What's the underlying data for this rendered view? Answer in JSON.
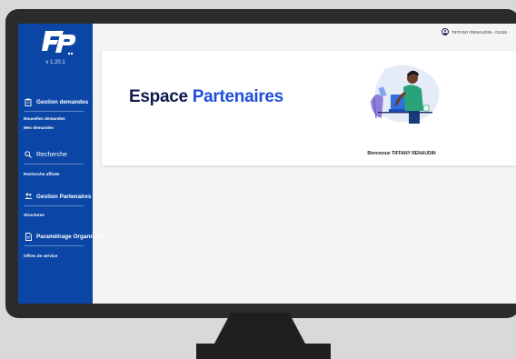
{
  "app": {
    "version": "v 1.20.1"
  },
  "sidebar": {
    "sections": [
      {
        "label": "Gestion demandes",
        "icon": "clipboard-icon"
      },
      {
        "label": "Recherche",
        "icon": "search-icon"
      },
      {
        "label": "Gestion Partenaires",
        "icon": "users-icon"
      },
      {
        "label": "Paramétrage Organisme",
        "icon": "document-icon"
      }
    ],
    "items": [
      {
        "label": "Nouvelles demandes"
      },
      {
        "label": "Mes demandes"
      },
      {
        "label": "Recherche affinée"
      },
      {
        "label": "Structures"
      },
      {
        "label": "Offres de service"
      }
    ]
  },
  "header": {
    "user_label": "TIFFANY RENAUDIN - 01316"
  },
  "main": {
    "title_part1": "Espace",
    "title_part2": "Partenaires",
    "welcome": "Bienvenue TIFFANY RENAUDIN"
  },
  "colors": {
    "sidebar": "#0b46a6",
    "title_dark": "#0f1a4d",
    "title_accent": "#1d4fd8"
  }
}
